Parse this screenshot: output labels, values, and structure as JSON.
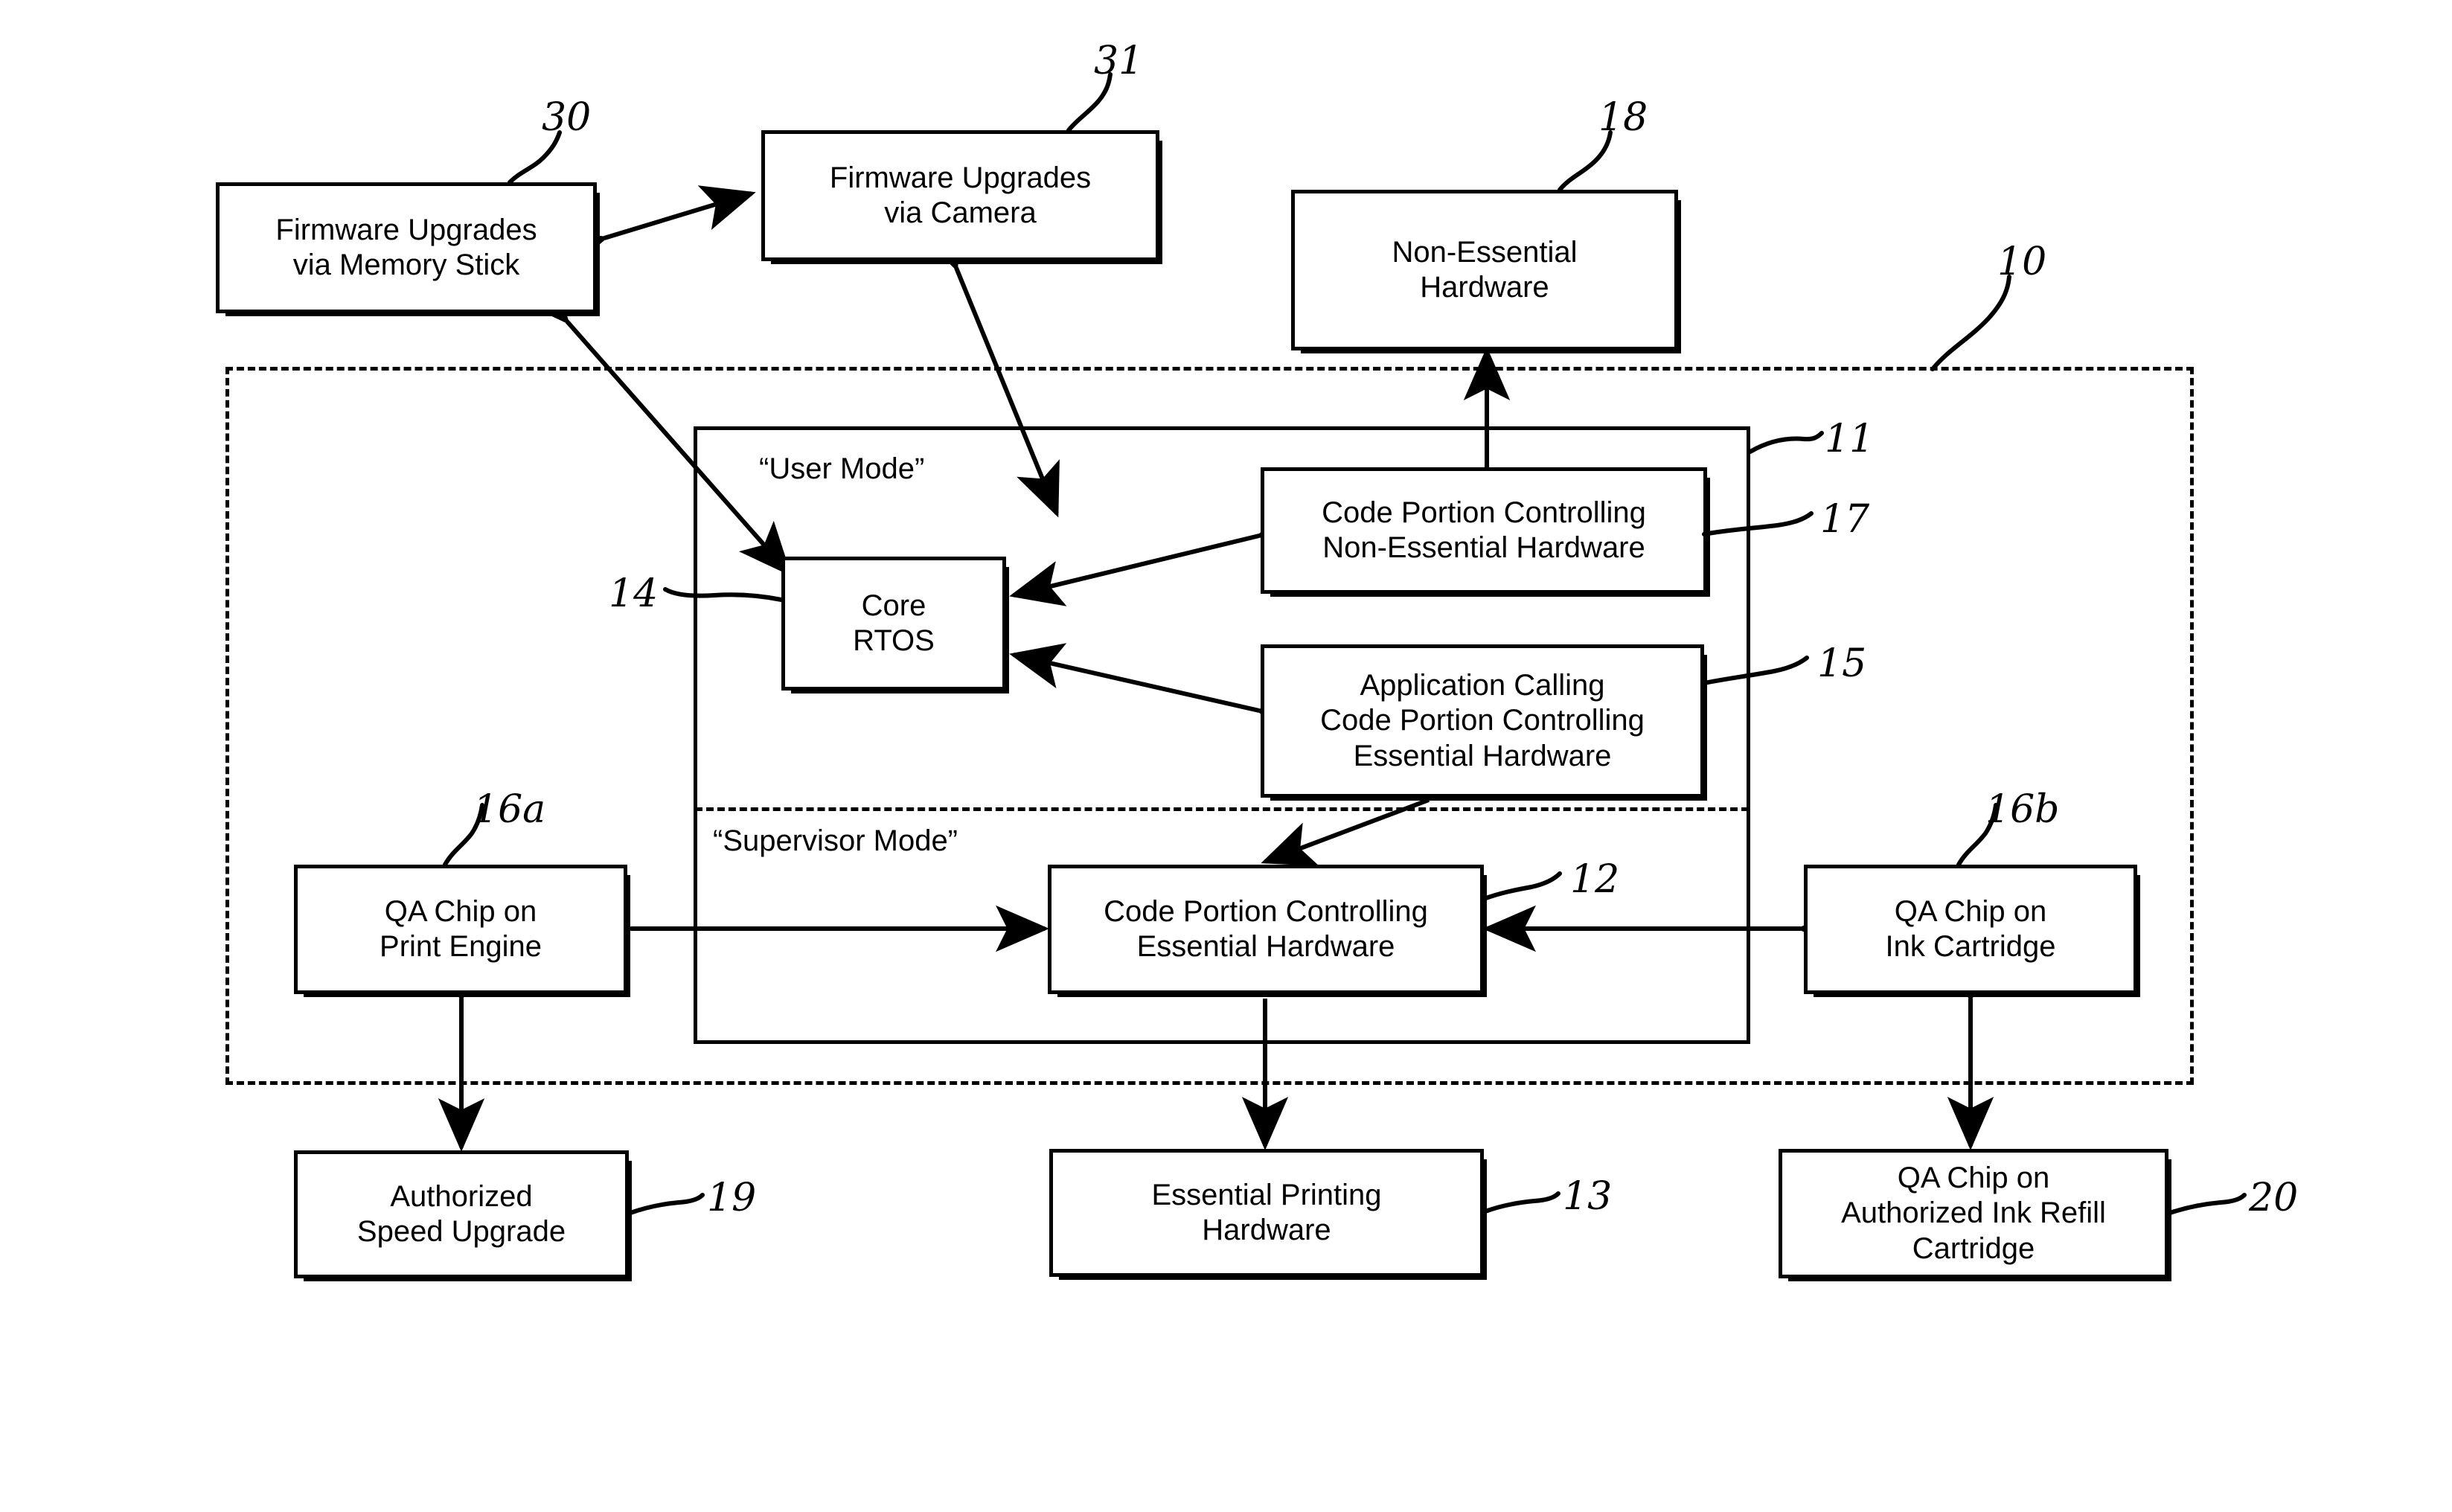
{
  "figure": {
    "title": "Printer system architecture block diagram",
    "line_color": "#000000",
    "background": "#ffffff"
  },
  "regions": {
    "outer": {
      "ref": "10",
      "style": "dashed"
    },
    "inner": {
      "ref": "11",
      "style": "solid"
    },
    "user_mode_caption": "“User Mode”",
    "supervisor_mode_caption": "“Supervisor Mode”"
  },
  "nodes": [
    {
      "id": "n30",
      "ref": "30",
      "label": "Firmware Upgrades\nvia Memory Stick"
    },
    {
      "id": "n31",
      "ref": "31",
      "label": "Firmware Upgrades\nvia Camera"
    },
    {
      "id": "n18",
      "ref": "18",
      "label": "Non-Essential\nHardware"
    },
    {
      "id": "n17",
      "ref": "17",
      "label": "Code Portion Controlling\nNon-Essential Hardware"
    },
    {
      "id": "n14",
      "ref": "14",
      "label": "Core\nRTOS"
    },
    {
      "id": "n15",
      "ref": "15",
      "label": "Application Calling\nCode Portion Controlling\nEssential Hardware"
    },
    {
      "id": "n12",
      "ref": "12",
      "label": "Code Portion Controlling\nEssential Hardware"
    },
    {
      "id": "n16a",
      "ref": "16a",
      "label": "QA Chip on\nPrint Engine"
    },
    {
      "id": "n16b",
      "ref": "16b",
      "label": "QA Chip on\nInk Cartridge"
    },
    {
      "id": "n19",
      "ref": "19",
      "label": "Authorized\nSpeed Upgrade"
    },
    {
      "id": "n13",
      "ref": "13",
      "label": "Essential Printing\nHardware"
    },
    {
      "id": "n20",
      "ref": "20",
      "label": "QA Chip on\nAuthorized Ink Refill\nCartridge"
    }
  ],
  "reference_numerals": [
    {
      "id": "r30",
      "text": "30"
    },
    {
      "id": "r31",
      "text": "31"
    },
    {
      "id": "r18",
      "text": "18"
    },
    {
      "id": "r10",
      "text": "10"
    },
    {
      "id": "r11",
      "text": "11"
    },
    {
      "id": "r17",
      "text": "17"
    },
    {
      "id": "r14",
      "text": "14"
    },
    {
      "id": "r15",
      "text": "15"
    },
    {
      "id": "r12",
      "text": "12"
    },
    {
      "id": "r16a",
      "text": "16a"
    },
    {
      "id": "r16b",
      "text": "16b"
    },
    {
      "id": "r19",
      "text": "19"
    },
    {
      "id": "r13",
      "text": "13"
    },
    {
      "id": "r20",
      "text": "20"
    }
  ],
  "connections": [
    {
      "from": "n30",
      "to": "n31",
      "arrows": "both"
    },
    {
      "from": "n30",
      "to": "n14",
      "arrows": "both"
    },
    {
      "from": "n31",
      "to": "n14",
      "arrows": "both"
    },
    {
      "from": "n17",
      "to": "n18",
      "arrows": "to"
    },
    {
      "from": "n17",
      "to": "n14",
      "arrows": "both"
    },
    {
      "from": "n15",
      "to": "n14",
      "arrows": "both"
    },
    {
      "from": "n15",
      "to": "n12",
      "arrows": "to"
    },
    {
      "from": "n16a",
      "to": "n12",
      "arrows": "both"
    },
    {
      "from": "n16b",
      "to": "n12",
      "arrows": "both"
    },
    {
      "from": "n16a",
      "to": "n19",
      "arrows": "both"
    },
    {
      "from": "n12",
      "to": "n13",
      "arrows": "to"
    },
    {
      "from": "n16b",
      "to": "n20",
      "arrows": "both"
    }
  ]
}
